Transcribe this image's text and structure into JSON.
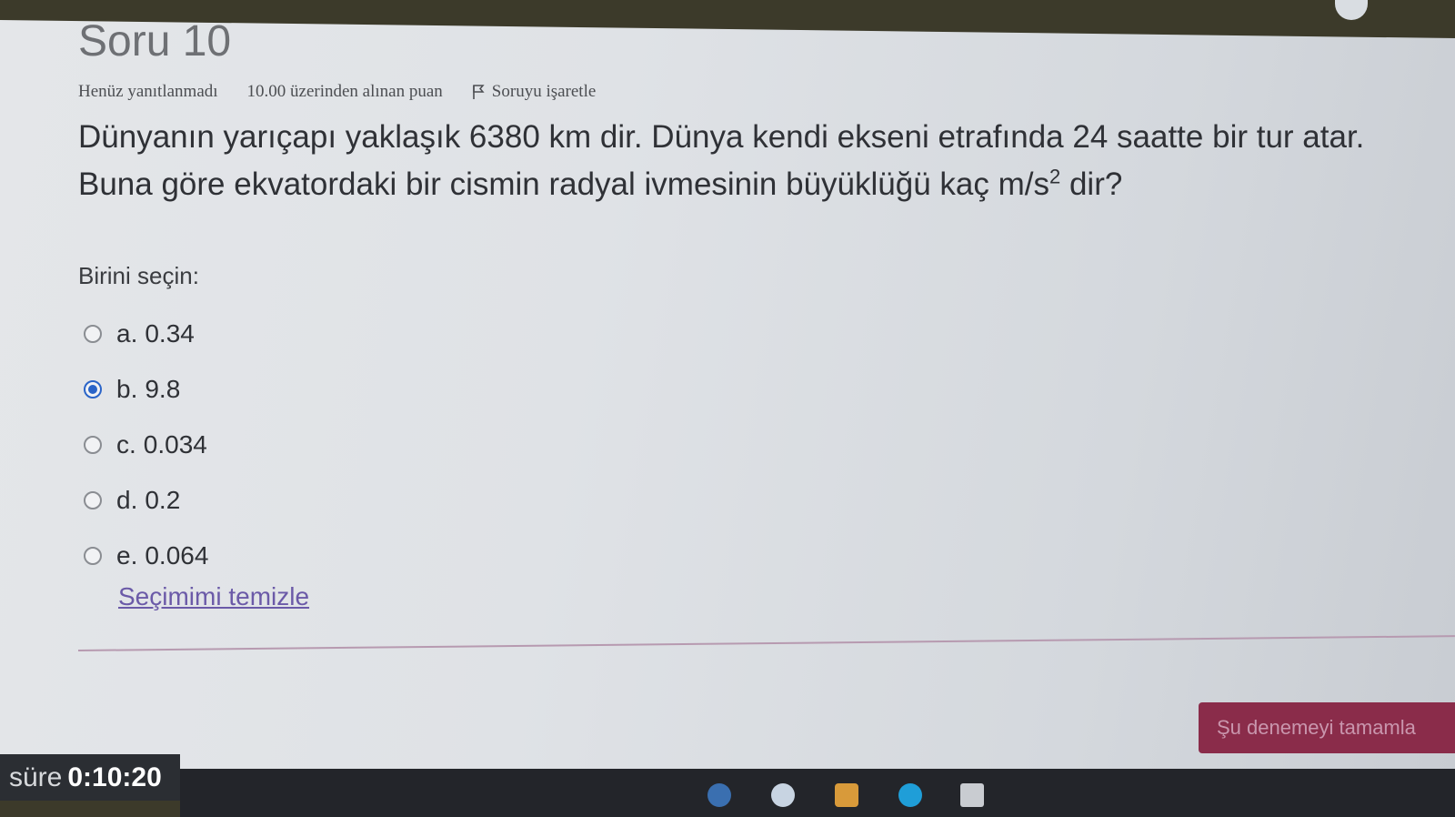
{
  "question": {
    "title": "Soru 10",
    "status": "Henüz yanıtlanmadı",
    "points": "10.00 üzerinden alınan puan",
    "flag_label": "Soruyu işaretle",
    "text_line1": "Dünyanın yarıçapı yaklaşık 6380 km dir. Dünya kendi ekseni etrafında 24 saatte bir tur atar.",
    "text_line2_pre": "Buna göre ekvatordaki bir cismin radyal ivmesinin büyüklüğü kaç m/s",
    "text_line2_sup": "2",
    "text_line2_post": " dir?"
  },
  "answer": {
    "prompt": "Birini seçin:",
    "options": [
      {
        "letter": "a.",
        "value": "0.34",
        "selected": false
      },
      {
        "letter": "b.",
        "value": "9.8",
        "selected": true
      },
      {
        "letter": "c.",
        "value": "0.034",
        "selected": false
      },
      {
        "letter": "d.",
        "value": "0.2",
        "selected": false
      },
      {
        "letter": "e.",
        "value": "0.064",
        "selected": false
      }
    ],
    "clear_label": "Seçimimi temizle"
  },
  "footer": {
    "finish_label": "Şu denemeyi tamamla",
    "timer_label": "süre",
    "timer_value": "0:10:20"
  },
  "colors": {
    "accent": "#2a64c8",
    "finish_button": "#8a2c4a",
    "link": "#6b5aa8"
  },
  "icons": {
    "flag": "flag-icon",
    "radio_checked": "radio-checked-icon",
    "radio_unchecked": "radio-unchecked-icon"
  }
}
